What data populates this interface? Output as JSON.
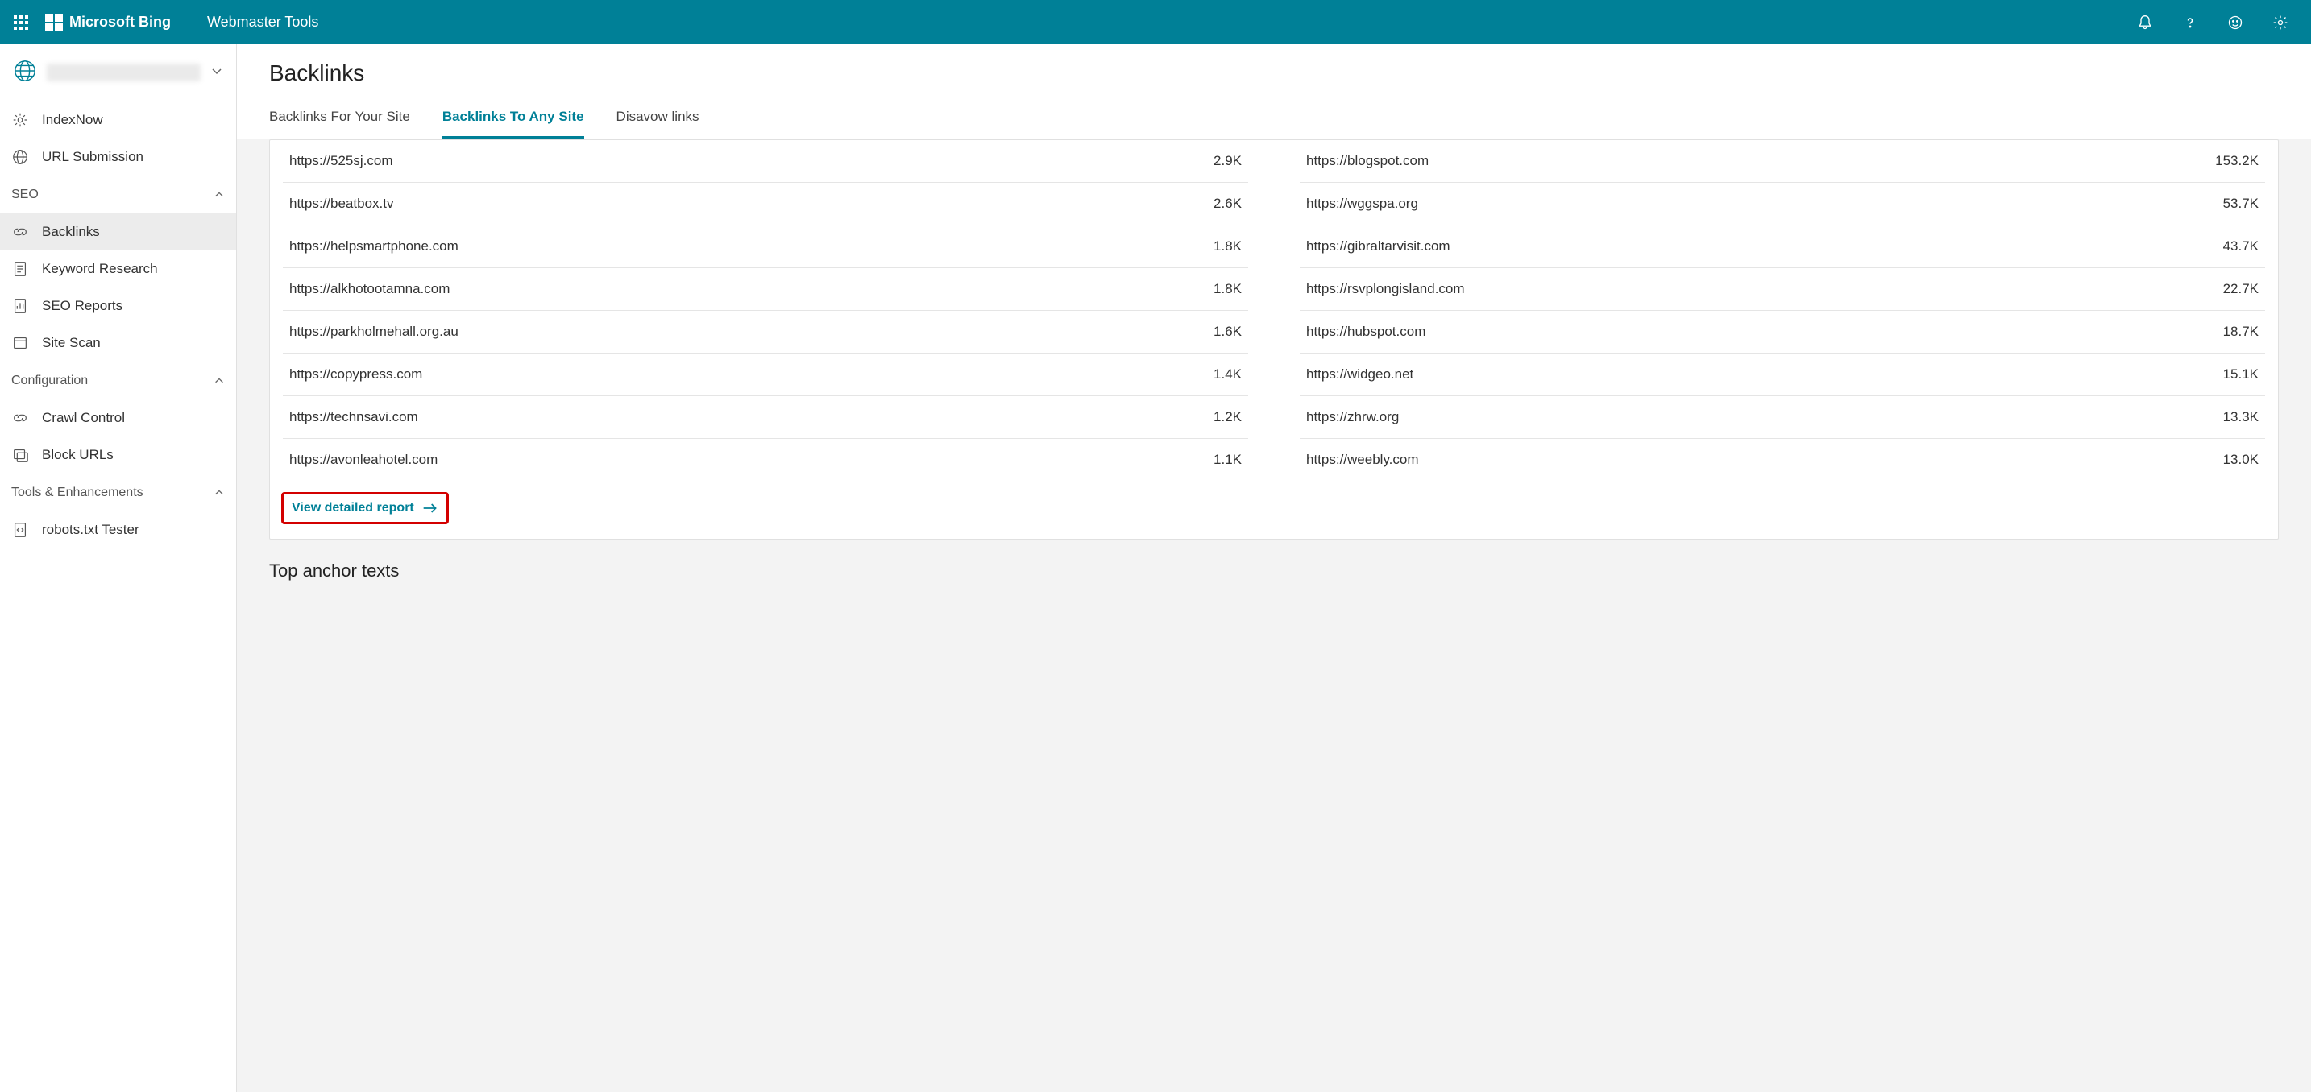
{
  "header": {
    "brand": "Microsoft Bing",
    "product": "Webmaster Tools"
  },
  "sidebar": {
    "index_now": "IndexNow",
    "url_submission": "URL Submission",
    "groups": {
      "seo": "SEO",
      "configuration": "Configuration",
      "tools": "Tools & Enhancements"
    },
    "seo_items": {
      "backlinks": "Backlinks",
      "keyword_research": "Keyword Research",
      "seo_reports": "SEO Reports",
      "site_scan": "Site Scan"
    },
    "config_items": {
      "crawl_control": "Crawl Control",
      "block_urls": "Block URLs"
    },
    "tools_items": {
      "robots": "robots.txt Tester"
    }
  },
  "page": {
    "title": "Backlinks",
    "tabs": {
      "for_your_site": "Backlinks For Your Site",
      "to_any_site": "Backlinks To Any Site",
      "disavow": "Disavow links"
    },
    "view_report": "View detailed report",
    "top_anchor_title": "Top anchor texts"
  },
  "lists": {
    "left": [
      {
        "url": "https://525sj.com",
        "count": "2.9K"
      },
      {
        "url": "https://beatbox.tv",
        "count": "2.6K"
      },
      {
        "url": "https://helpsmartphone.com",
        "count": "1.8K"
      },
      {
        "url": "https://alkhotootamna.com",
        "count": "1.8K"
      },
      {
        "url": "https://parkholmehall.org.au",
        "count": "1.6K"
      },
      {
        "url": "https://copypress.com",
        "count": "1.4K"
      },
      {
        "url": "https://technsavi.com",
        "count": "1.2K"
      },
      {
        "url": "https://avonleahotel.com",
        "count": "1.1K"
      }
    ],
    "right": [
      {
        "url": "https://blogspot.com",
        "count": "153.2K"
      },
      {
        "url": "https://wggspa.org",
        "count": "53.7K"
      },
      {
        "url": "https://gibraltarvisit.com",
        "count": "43.7K"
      },
      {
        "url": "https://rsvplongisland.com",
        "count": "22.7K"
      },
      {
        "url": "https://hubspot.com",
        "count": "18.7K"
      },
      {
        "url": "https://widgeo.net",
        "count": "15.1K"
      },
      {
        "url": "https://zhrw.org",
        "count": "13.3K"
      },
      {
        "url": "https://weebly.com",
        "count": "13.0K"
      }
    ]
  }
}
